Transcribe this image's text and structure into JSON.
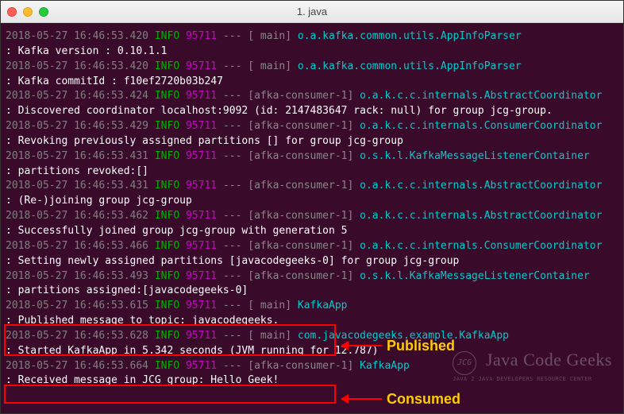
{
  "window": {
    "title": "1. java"
  },
  "log": [
    {
      "ts": "2018-05-27 16:46:53.420",
      "level": "INFO",
      "pid": "95711",
      "thread": "main",
      "class": "o.a.kafka.common.utils.AppInfoParser",
      "cont": ": Kafka version : 0.10.1.1"
    },
    {
      "ts": "2018-05-27 16:46:53.420",
      "level": "INFO",
      "pid": "95711",
      "thread": "main",
      "class": "o.a.kafka.common.utils.AppInfoParser",
      "cont": ": Kafka commitId : f10ef2720b03b247"
    },
    {
      "ts": "2018-05-27 16:46:53.424",
      "level": "INFO",
      "pid": "95711",
      "thread": "afka-consumer-1",
      "class": "o.a.k.c.c.internals.AbstractCoordinator",
      "cont": ": Discovered coordinator localhost:9092 (id: 2147483647 rack: null) for group jcg-group."
    },
    {
      "ts": "2018-05-27 16:46:53.429",
      "level": "INFO",
      "pid": "95711",
      "thread": "afka-consumer-1",
      "class": "o.a.k.c.c.internals.ConsumerCoordinator",
      "cont": ": Revoking previously assigned partitions [] for group jcg-group"
    },
    {
      "ts": "2018-05-27 16:46:53.431",
      "level": "INFO",
      "pid": "95711",
      "thread": "afka-consumer-1",
      "class": "o.s.k.l.KafkaMessageListenerContainer",
      "cont": ": partitions revoked:[]"
    },
    {
      "ts": "2018-05-27 16:46:53.431",
      "level": "INFO",
      "pid": "95711",
      "thread": "afka-consumer-1",
      "class": "o.a.k.c.c.internals.AbstractCoordinator",
      "cont": ": (Re-)joining group jcg-group"
    },
    {
      "ts": "2018-05-27 16:46:53.462",
      "level": "INFO",
      "pid": "95711",
      "thread": "afka-consumer-1",
      "class": "o.a.k.c.c.internals.AbstractCoordinator",
      "cont": ": Successfully joined group jcg-group with generation 5"
    },
    {
      "ts": "2018-05-27 16:46:53.466",
      "level": "INFO",
      "pid": "95711",
      "thread": "afka-consumer-1",
      "class": "o.a.k.c.c.internals.ConsumerCoordinator",
      "cont": ": Setting newly assigned partitions [javacodegeeks-0] for group jcg-group"
    },
    {
      "ts": "2018-05-27 16:46:53.493",
      "level": "INFO",
      "pid": "95711",
      "thread": "afka-consumer-1",
      "class": "o.s.k.l.KafkaMessageListenerContainer",
      "cont": ": partitions assigned:[javacodegeeks-0]"
    },
    {
      "ts": "2018-05-27 16:46:53.615",
      "level": "INFO",
      "pid": "95711",
      "thread": "main",
      "class": "KafkaApp",
      "cont": ": Published message to topic: javacodegeeks."
    },
    {
      "ts": "2018-05-27 16:46:53.628",
      "level": "INFO",
      "pid": "95711",
      "thread": "main",
      "class": "com.javacodegeeks.example.KafkaApp",
      "cont": ": Started KafkaApp in 5.342 seconds (JVM running for 12.787)"
    },
    {
      "ts": "2018-05-27 16:46:53.664",
      "level": "INFO",
      "pid": "95711",
      "thread": "afka-consumer-1",
      "class": "KafkaApp",
      "cont": ": Received message in JCG group: Hello Geek!"
    }
  ],
  "annotations": {
    "published": "Published",
    "consumed": "Consumed"
  },
  "watermark": {
    "logo": "JCG",
    "main": "Java Code Geeks",
    "sub": "Java 2 Java Developers Resource Center"
  }
}
